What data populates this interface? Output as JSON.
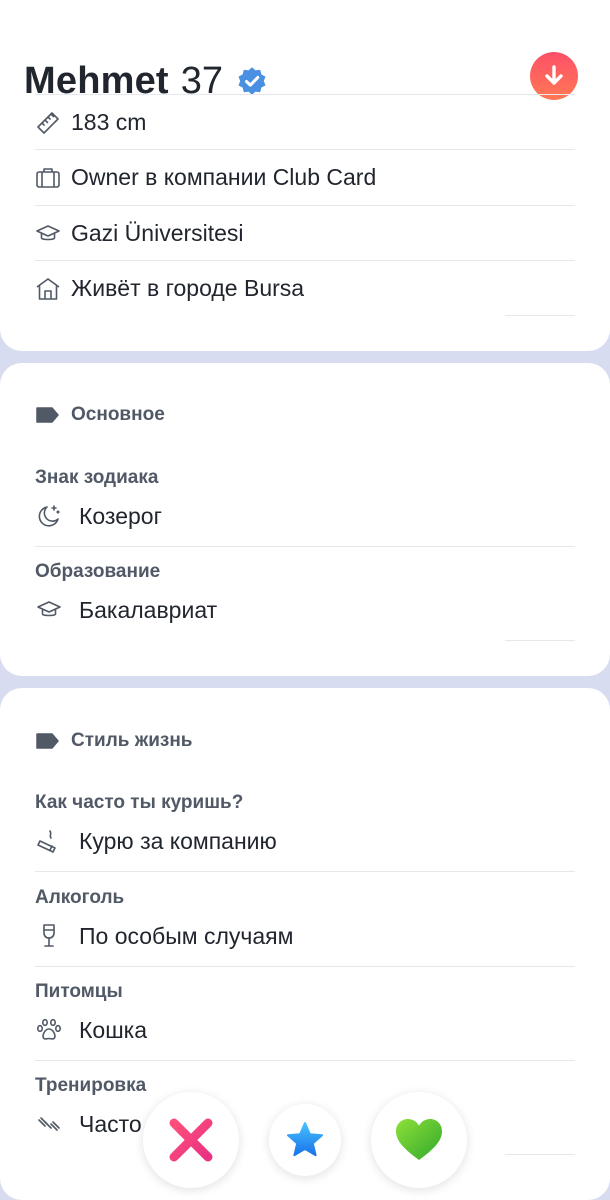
{
  "profile": {
    "name": "Mehmet",
    "age": "37",
    "verified_icon": "verified-badge-icon",
    "collapse_icon": "arrow-down-icon",
    "accent_color": "#fd5068"
  },
  "info": [
    {
      "icon": "ruler-icon",
      "text": "183 cm"
    },
    {
      "icon": "briefcase-icon",
      "text": "Owner в компании Club Card"
    },
    {
      "icon": "graduation-cap-icon",
      "text": "Gazi Üniversitesi"
    },
    {
      "icon": "home-icon",
      "text": "Живёт в городе Bursa"
    }
  ],
  "basics": {
    "title": "Основное",
    "fields": [
      {
        "label": "Знак зодиака",
        "icon": "moon-icon",
        "value": "Козерог"
      },
      {
        "label": "Образование",
        "icon": "graduation-cap-icon",
        "value": "Бакалавриат"
      }
    ]
  },
  "lifestyle": {
    "title": "Стиль жизнь",
    "fields": [
      {
        "label": "Как часто ты куришь?",
        "icon": "cigarette-icon",
        "value": "Курю за компанию"
      },
      {
        "label": "Алкоголь",
        "icon": "wine-glass-icon",
        "value": "По особым случаям"
      },
      {
        "label": "Питомцы",
        "icon": "paw-icon",
        "value": "Кошка"
      },
      {
        "label": "Тренировка",
        "icon": "dumbbell-icon",
        "value": "Часто"
      }
    ]
  },
  "actions": {
    "nope_icon": "cross-icon",
    "super_like_icon": "star-icon",
    "like_icon": "heart-icon"
  }
}
